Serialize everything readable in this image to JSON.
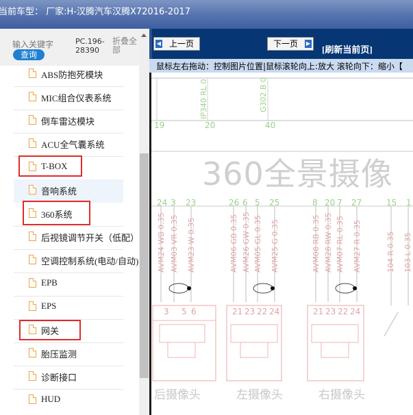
{
  "titlebar": {
    "text": "当前车型：  厂家:H-汉腾汽车汉腾X72016-2017"
  },
  "left": {
    "keyword_placeholder": "输入关键字",
    "query_button": "查询",
    "pc_label": "PC.196-28390",
    "fold_all": "折叠全部",
    "items": [
      {
        "label": "ABS防抱死模块"
      },
      {
        "label": "MIC组合仪表系统"
      },
      {
        "label": "倒车雷达模块"
      },
      {
        "label": "ACU全气囊系统"
      },
      {
        "label": "T-BOX"
      },
      {
        "label": "音响系统"
      },
      {
        "label": "360系统"
      },
      {
        "label": "后视镜调节开关（低配）"
      },
      {
        "label": "空调控制系统(电动/自动)"
      },
      {
        "label": "EPB"
      },
      {
        "label": "EPS"
      },
      {
        "label": "网关"
      },
      {
        "label": "胎压监测"
      },
      {
        "label": "诊断接口"
      },
      {
        "label": "HUD"
      }
    ]
  },
  "right": {
    "prev_button": "上一页",
    "next_button": "下一页",
    "refresh": "[刷新当前页]",
    "hint": "鼠标左右拖动：控制图片位置|鼠标滚轮向上:放大  滚轮向下：缩小【"
  },
  "diagram": {
    "title": "360全景摄像",
    "top_codes": [
      "IP340 RL 0",
      "G302 B 0"
    ],
    "top_numbers": [
      "19",
      "20",
      "40"
    ],
    "pin_numbers": [
      "24",
      "3",
      "23",
      "26",
      "6",
      "5",
      "25",
      "8",
      "20",
      "7",
      "27",
      "15",
      "1"
    ],
    "wire_codes": [
      "AVM24 WB 0.35",
      "AVM03 VR 0.35",
      "AVM23 W 0.35",
      "AVM06 GB 0.35",
      "AVM26 GW 0.35",
      "AVM05 GL 0.35",
      "AVM25 G 0.35",
      "AVM08 RB 0.35",
      "AVM28 RW 0.35",
      "AVM07 RL 0.35",
      "AVM27 R 0.35",
      "104 R 0.35",
      "103 L 0.35"
    ],
    "connector_pins": [
      "3",
      "5",
      "6",
      "21",
      "23",
      "22",
      "24",
      "21",
      "23",
      "22",
      "24"
    ],
    "camera_labels": [
      "后摄像头",
      "左摄像头",
      "右摄像头"
    ]
  }
}
